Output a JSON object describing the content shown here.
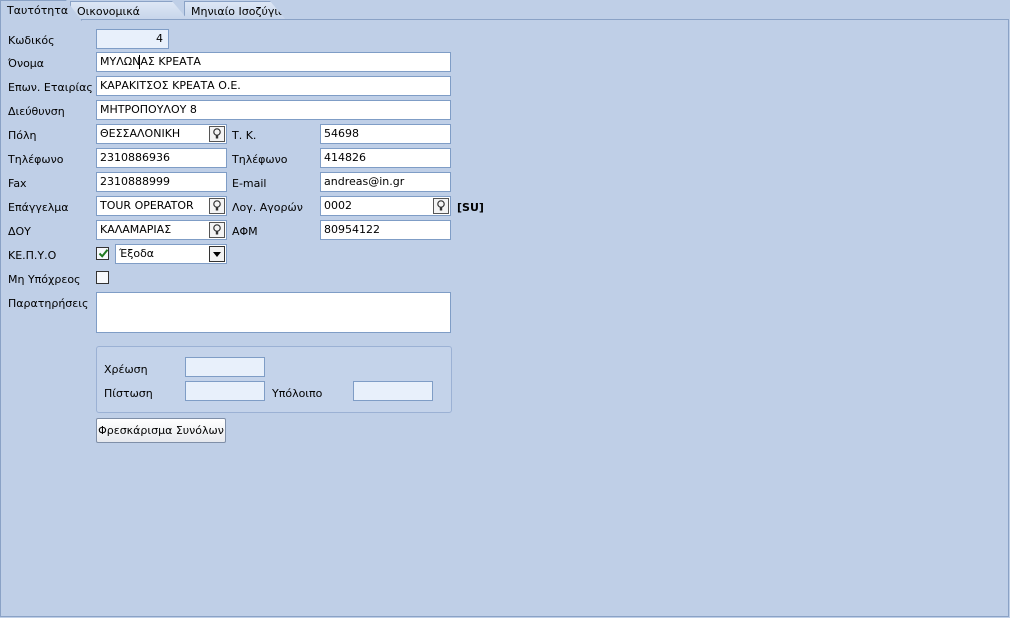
{
  "tabs": [
    "Ταυτότητα",
    "Οικονομικά Στοιχεία",
    "Μηνιαίο Ισοζύγιο"
  ],
  "fields": {
    "code": {
      "label": "Κωδικός",
      "value": "4"
    },
    "name": {
      "label": "Όνομα",
      "value": "ΜΥΛΩΝΑΣ ΚΡΕΑΤΑ"
    },
    "company": {
      "label": "Επων. Εταιρίας",
      "value": "ΚΑΡΑΚΙΤΣΟΣ ΚΡΕΑΤΑ Ο.Ε."
    },
    "address": {
      "label": "Διεύθυνση",
      "value": "ΜΗΤΡΟΠΟΥΛΟΥ 8"
    },
    "city": {
      "label": "Πόλη",
      "value": "ΘΕΣΣΑΛΟΝΙΚΗ"
    },
    "zip": {
      "label": "Τ. Κ.",
      "value": "54698"
    },
    "phone1": {
      "label": "Τηλέφωνο",
      "value": "2310886936"
    },
    "phone2": {
      "label": "Τηλέφωνο",
      "value": "414826"
    },
    "fax": {
      "label": "Fax",
      "value": "2310888999"
    },
    "email": {
      "label": "E-mail",
      "value": "andreas@in.gr"
    },
    "profession": {
      "label": "Επάγγελμα",
      "value": "TOUR OPERATOR"
    },
    "account": {
      "label": "Λογ. Αγορών",
      "value": "0002",
      "suffix": "[SU]"
    },
    "tax_office": {
      "label": "ΔΟΥ",
      "value": "ΚΑΛΑΜΑΡΙΑΣ"
    },
    "vat": {
      "label": "ΑΦΜ",
      "value": "80954122"
    },
    "kepyo": {
      "label": "ΚΕ.Π.Υ.Ο",
      "checked": true,
      "select_value": "Έξοδα"
    },
    "not_obliged": {
      "label": "Μη Υπόχρεος",
      "checked": false
    },
    "notes": {
      "label": "Παρατηρήσεις",
      "value": ""
    }
  },
  "totals": {
    "debit_label": "Χρέωση",
    "credit_label": "Πίστωση",
    "balance_label": "Υπόλοιπο"
  },
  "refresh_button": "Φρεσκάρισμα Συνόλων"
}
